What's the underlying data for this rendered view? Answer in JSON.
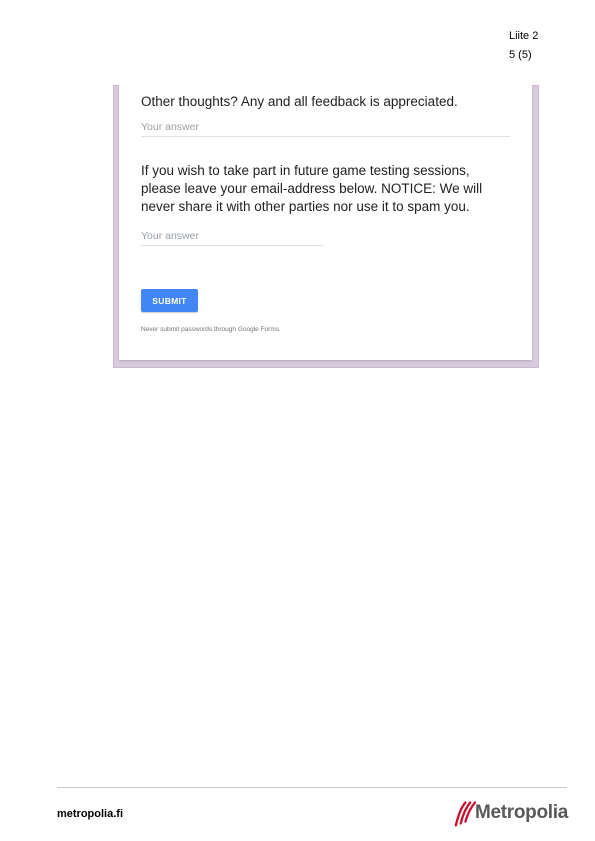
{
  "header": {
    "appendix_label": "Liite 2",
    "page_number": "5 (5)"
  },
  "form": {
    "question_feedback": "Other thoughts? Any and all feedback is appreciated.",
    "answer_feedback_placeholder": "Your answer",
    "question_email": "If you wish to take part in future game testing sessions, please leave your email-address below. NOTICE: We will never share it with other parties nor use it to spam you.",
    "answer_email_placeholder": "Your answer",
    "submit_label": "SUBMIT",
    "disclaimer": "Never submit passwords through Google Forms.",
    "accent_color": "#4285f4"
  },
  "footer": {
    "site": "metropolia.fi",
    "logo_text": "Metropolia",
    "logo_icon": "metropolia-logo-icon",
    "logo_color": "#c8102e"
  }
}
